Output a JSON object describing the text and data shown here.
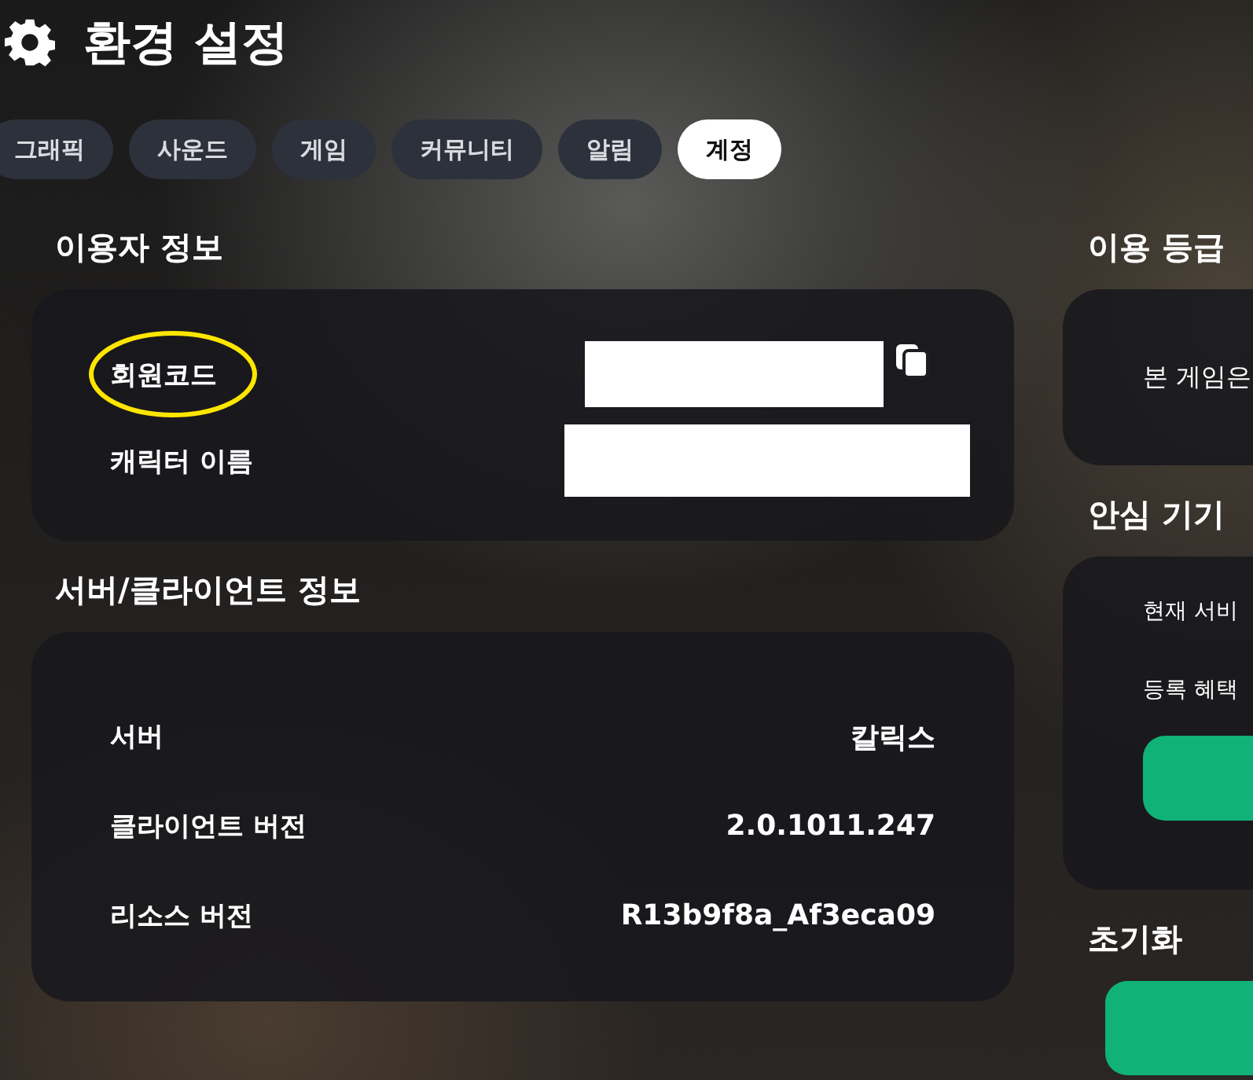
{
  "window": {
    "title": "환경 설정"
  },
  "tabs": [
    {
      "label": "그래픽",
      "selected": false
    },
    {
      "label": "사운드",
      "selected": false
    },
    {
      "label": "게임",
      "selected": false
    },
    {
      "label": "커뮤니티",
      "selected": false
    },
    {
      "label": "알림",
      "selected": false
    },
    {
      "label": "계정",
      "selected": true
    }
  ],
  "user_info": {
    "heading": "이용자 정보",
    "rows": [
      {
        "label": "회원코드",
        "highlighted": true,
        "copyable": true
      },
      {
        "label": "캐릭터 이름",
        "highlighted": false,
        "copyable": false
      }
    ]
  },
  "server_info": {
    "heading": "서버/클라이언트 정보",
    "rows": [
      {
        "label": "서버",
        "value": "칼릭스"
      },
      {
        "label": "클라이언트 버전",
        "value": "2.0.1011.247"
      },
      {
        "label": "리소스 버전",
        "value": "R13b9f8a_Af3eca09"
      }
    ]
  },
  "rating": {
    "heading": "이용 등급",
    "text": "본 게임은"
  },
  "safe_device": {
    "heading": "안심 기기",
    "lines": [
      "현재 서비",
      "등록 혜택"
    ]
  },
  "reset": {
    "heading": "초기화"
  }
}
